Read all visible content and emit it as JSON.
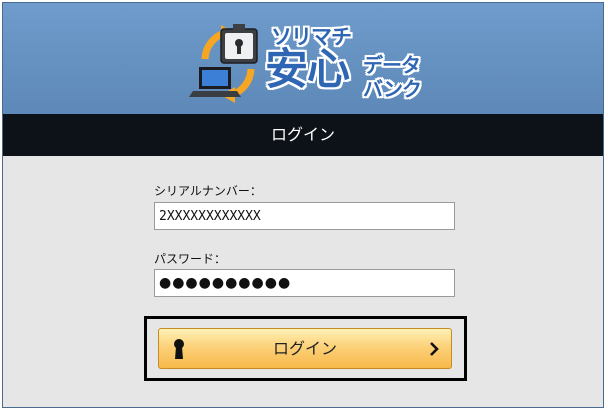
{
  "logo": {
    "line1": "ソリマチ",
    "line2": "安心",
    "line3a": "データ",
    "line3b": "バンク"
  },
  "titlebar": {
    "title": "ログイン"
  },
  "form": {
    "serial_label": "シリアルナンバー：",
    "serial_value": "2XXXXXXXXXXXX",
    "password_label": "パスワード：",
    "password_value": "●●●●●●●●●●"
  },
  "login_button": {
    "label": "ログイン",
    "icon_left": "keyhole-icon",
    "icon_right": "chevron-right-icon"
  },
  "colors": {
    "header_blue": "#6f9ccc",
    "titlebar_black": "#0d1218",
    "button_orange": "#f7b94a",
    "logo_text_blue": "#2f66b3"
  }
}
